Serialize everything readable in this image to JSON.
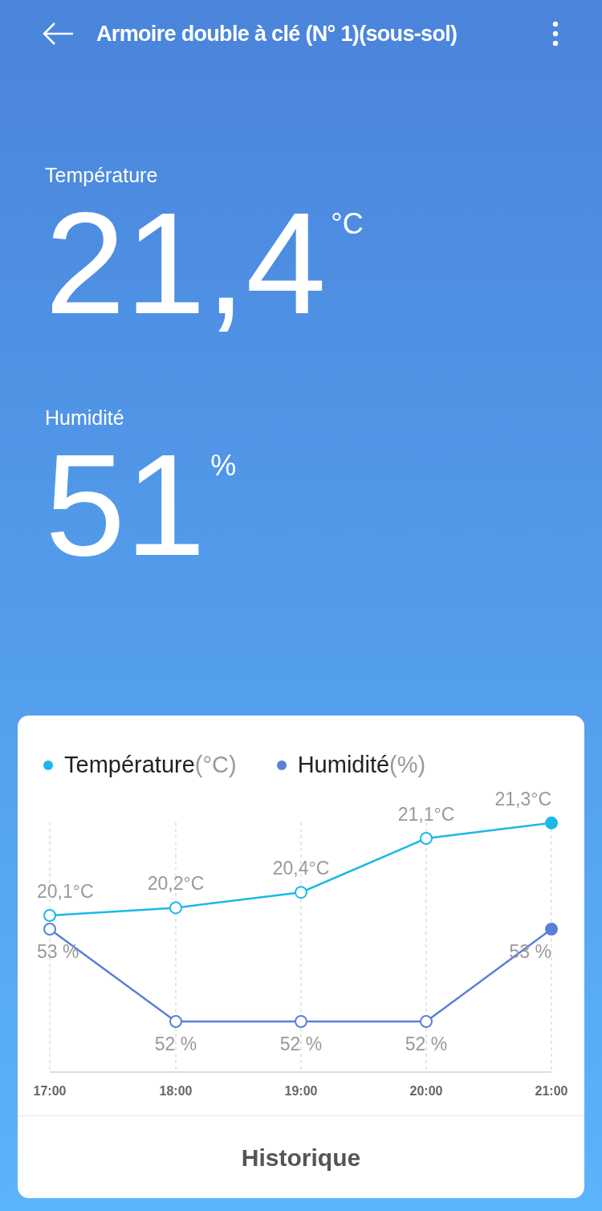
{
  "header": {
    "title": "Armoire double à clé (N° 1)(sous-sol)"
  },
  "readings": [
    {
      "label": "Température",
      "value": "21,4",
      "unit": "°C"
    },
    {
      "label": "Humidité",
      "value": "51",
      "unit": "%"
    }
  ],
  "chart": {
    "legend_units": [
      "(°C)",
      "(%)"
    ],
    "charts": [
      {
        "chart_data": {
          "type": "line",
          "categories": [
            "17:00",
            "18:00",
            "19:00",
            "20:00",
            "21:00"
          ],
          "grid": true,
          "data_labels": true,
          "series": [
            {
              "name": "Température",
              "color": "#1cb8ea",
              "marker": "circle",
              "values": [
                20.1,
                20.2,
                20.4,
                21.1,
                21.3
              ],
              "value_labels": [
                "20,1°C",
                "20,2°C",
                "20,4°C",
                "21,1°C",
                "21,3°C"
              ]
            }
          ]
        }
      },
      {
        "chart_data": {
          "type": "line",
          "data_labels": true,
          "series": [
            {
              "name": "Humidité",
              "color": "#5b7fd9",
              "marker": "circle",
              "values": [
                53,
                52,
                52,
                52,
                53
              ],
              "value_labels": [
                "53 %",
                "52 %",
                "52 %",
                "52 %",
                "53 %"
              ]
            }
          ]
        }
      }
    ]
  },
  "footer_button": "Historique"
}
